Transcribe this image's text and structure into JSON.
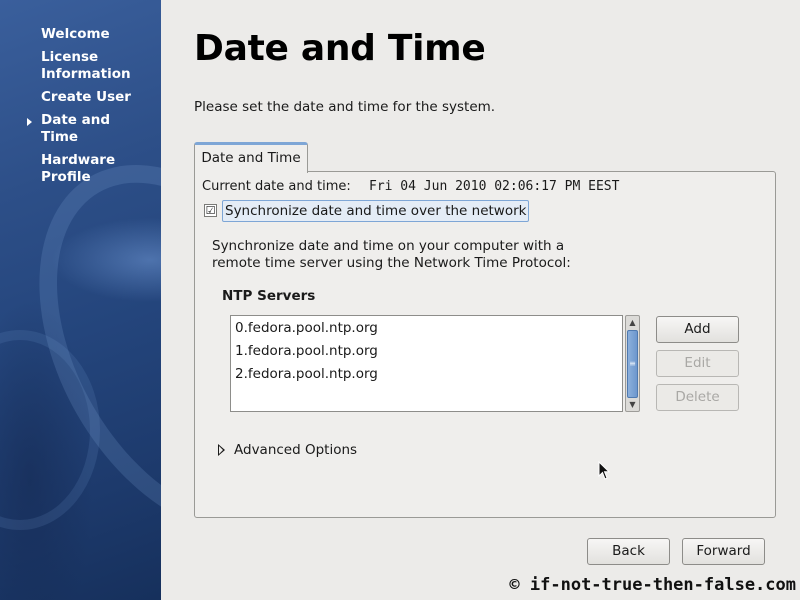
{
  "sidebar": {
    "items": [
      {
        "label": "Welcome"
      },
      {
        "label": "License Information"
      },
      {
        "label": "Create User"
      },
      {
        "label": "Date and Time"
      },
      {
        "label": "Hardware Profile"
      }
    ],
    "current": "Date and Time"
  },
  "page": {
    "title": "Date and Time",
    "subtitle": "Please set the date and time for the system."
  },
  "tab": {
    "label": "Date and Time"
  },
  "current_time": {
    "label": "Current date and time:",
    "value": "Fri 04 Jun 2010 02:06:17 PM EEST"
  },
  "sync": {
    "checked": true,
    "check_glyph": "☑",
    "label": "Synchronize date and time over the network",
    "description": "Synchronize date and time on your computer with a remote time server using the Network Time Protocol:"
  },
  "ntp": {
    "heading": "NTP Servers",
    "servers": [
      "0.fedora.pool.ntp.org",
      "1.fedora.pool.ntp.org",
      "2.fedora.pool.ntp.org"
    ],
    "buttons": {
      "add": {
        "label": "Add",
        "enabled": true
      },
      "edit": {
        "label": "Edit",
        "enabled": false
      },
      "delete": {
        "label": "Delete",
        "enabled": false
      }
    },
    "scroll_up_glyph": "▲",
    "scroll_down_glyph": "▼",
    "scroll_thumb_glyph": "≡"
  },
  "advanced": {
    "label": "Advanced Options",
    "expanded": false
  },
  "footer": {
    "back_label": "Back",
    "forward_label": "Forward"
  },
  "watermark": "© if-not-true-then-false.com",
  "colors": {
    "accent": "#7ea6d6",
    "sidebar": "#24457c",
    "background": "#ecebe9"
  }
}
